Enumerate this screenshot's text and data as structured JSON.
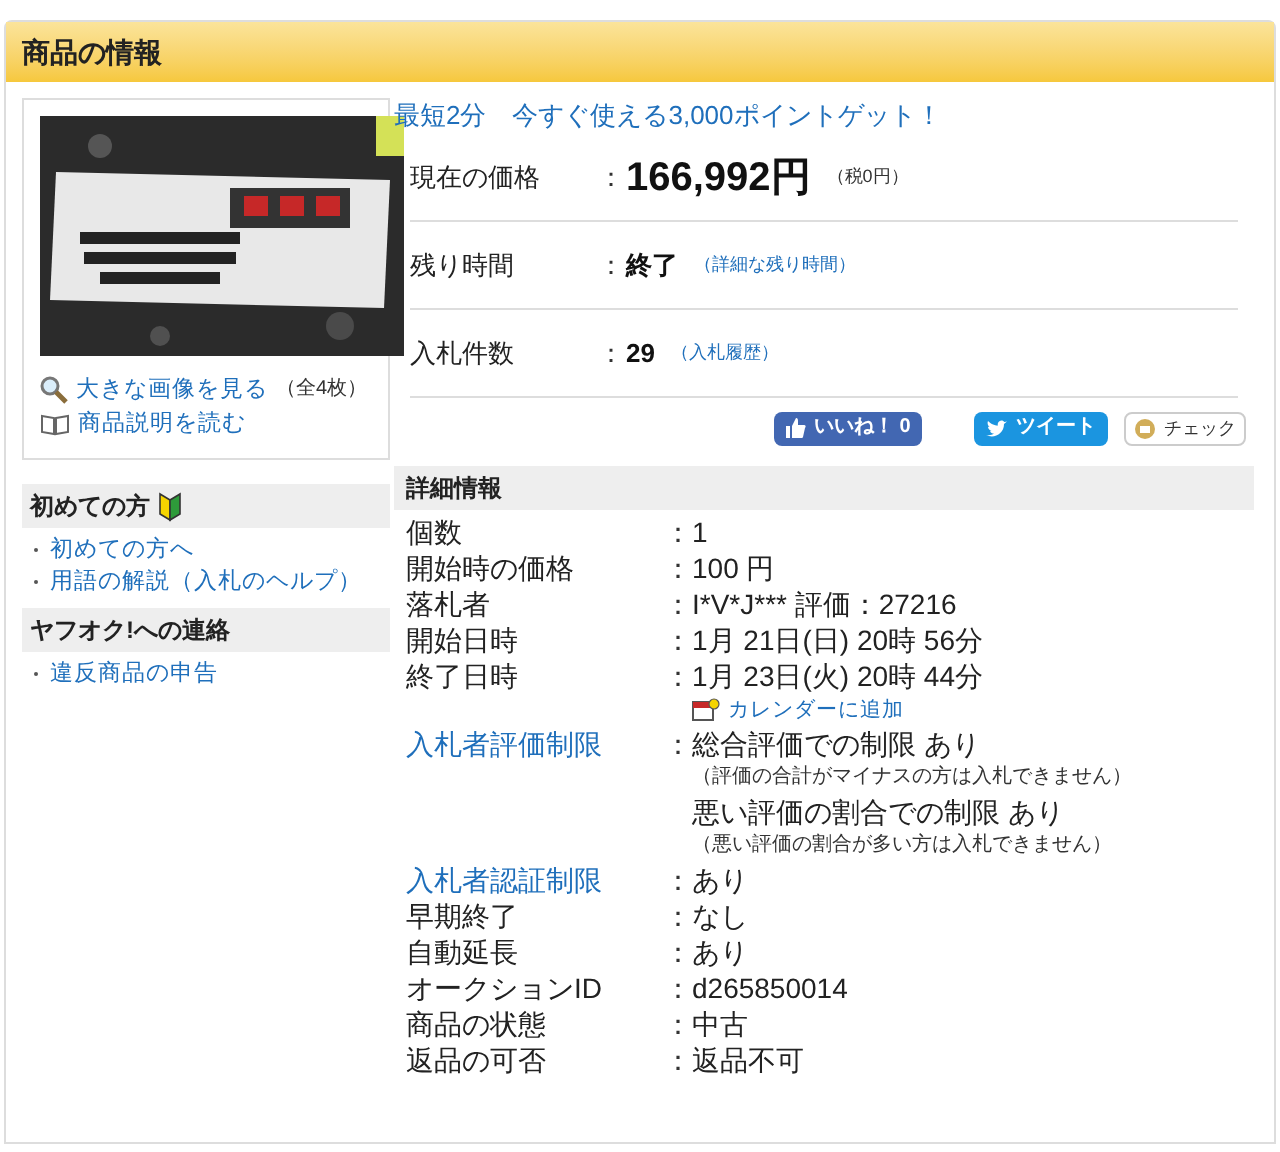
{
  "header": {
    "title": "商品の情報"
  },
  "separator": "：",
  "image_links": [
    {
      "kind": "zoom",
      "text": "大きな画像を見る",
      "note": "（全4枚）"
    },
    {
      "kind": "book",
      "text": "商品説明を読む"
    }
  ],
  "promo": "最短2分　今すぐ使える3,000ポイントゲット！",
  "summary": [
    {
      "label": "現在の価格",
      "value": "166,992円",
      "note": "（税0円）",
      "kind": "price"
    },
    {
      "label": "残り時間",
      "value": "終了",
      "note": "（詳細な残り時間）",
      "kind": "plain"
    },
    {
      "label": "入札件数",
      "value": "29",
      "note": "（入札履歴）",
      "kind": "plain"
    }
  ],
  "social": [
    {
      "kind": "like",
      "text": "いいね！",
      "count": "0"
    },
    {
      "kind": "tweet",
      "text": "ツイート"
    },
    {
      "kind": "check",
      "text": "チェック"
    }
  ],
  "sidebar": [
    {
      "title": "初めての方",
      "beginner_mark": true,
      "links": [
        "初めての方へ",
        "用語の解説（入札のヘルプ）"
      ]
    },
    {
      "title": "ヤフオク!への連絡",
      "beginner_mark": false,
      "links": [
        "違反商品の申告"
      ]
    }
  ],
  "details": {
    "title": "詳細情報",
    "rows": [
      {
        "label": "個数",
        "link": false,
        "lines": [
          {
            "text": "1"
          }
        ]
      },
      {
        "label": "開始時の価格",
        "link": false,
        "lines": [
          {
            "text": "100 円"
          }
        ]
      },
      {
        "label": "落札者",
        "link": false,
        "lines": [
          {
            "text": "I*V*J*** 評価：27216"
          }
        ]
      },
      {
        "label": "開始日時",
        "link": false,
        "lines": [
          {
            "text": "1月 21日(日) 20時 56分"
          }
        ]
      },
      {
        "label": "終了日時",
        "link": false,
        "lines": [
          {
            "text": "1月 23日(火) 20時 44分"
          }
        ],
        "calendar_link": "カレンダーに追加"
      },
      {
        "label": "入札者評価制限",
        "link": true,
        "lines": [
          {
            "text": "総合評価での制限 あり",
            "note": "（評価の合計がマイナスの方は入札できません）"
          },
          {
            "text": "悪い評価の割合での制限 あり",
            "note": "（悪い評価の割合が多い方は入札できません）"
          }
        ]
      },
      {
        "label": "入札者認証制限",
        "link": true,
        "lines": [
          {
            "text": "あり"
          }
        ]
      },
      {
        "label": "早期終了",
        "link": false,
        "lines": [
          {
            "text": "なし"
          }
        ]
      },
      {
        "label": "自動延長",
        "link": false,
        "lines": [
          {
            "text": "あり"
          }
        ]
      },
      {
        "label": "オークションID",
        "link": false,
        "lines": [
          {
            "text": "d265850014"
          }
        ]
      },
      {
        "label": "商品の状態",
        "link": false,
        "lines": [
          {
            "text": "中古"
          }
        ]
      },
      {
        "label": "返品の可否",
        "link": false,
        "lines": [
          {
            "text": "返品不可"
          }
        ]
      }
    ]
  }
}
